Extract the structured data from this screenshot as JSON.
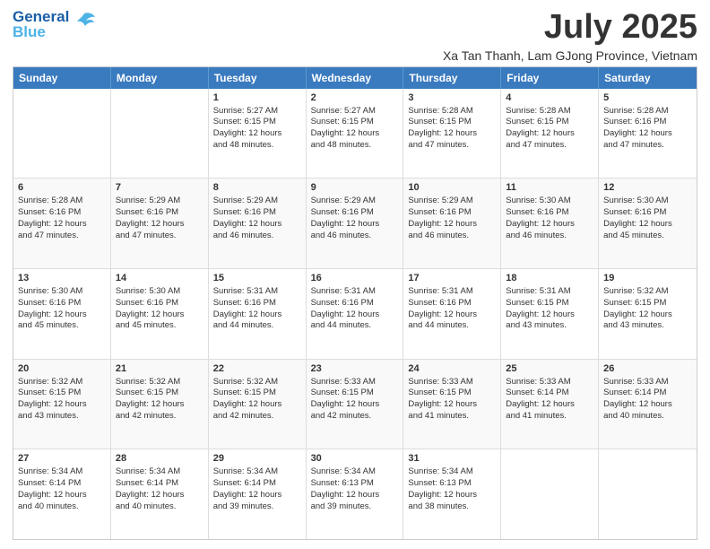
{
  "header": {
    "logo_line1": "General",
    "logo_line2": "Blue",
    "month": "July 2025",
    "location": "Xa Tan Thanh, Lam GJong Province, Vietnam"
  },
  "days_of_week": [
    "Sunday",
    "Monday",
    "Tuesday",
    "Wednesday",
    "Thursday",
    "Friday",
    "Saturday"
  ],
  "weeks": [
    [
      {
        "day": "",
        "info": ""
      },
      {
        "day": "",
        "info": ""
      },
      {
        "day": "1",
        "info": "Sunrise: 5:27 AM\nSunset: 6:15 PM\nDaylight: 12 hours\nand 48 minutes."
      },
      {
        "day": "2",
        "info": "Sunrise: 5:27 AM\nSunset: 6:15 PM\nDaylight: 12 hours\nand 48 minutes."
      },
      {
        "day": "3",
        "info": "Sunrise: 5:28 AM\nSunset: 6:15 PM\nDaylight: 12 hours\nand 47 minutes."
      },
      {
        "day": "4",
        "info": "Sunrise: 5:28 AM\nSunset: 6:15 PM\nDaylight: 12 hours\nand 47 minutes."
      },
      {
        "day": "5",
        "info": "Sunrise: 5:28 AM\nSunset: 6:16 PM\nDaylight: 12 hours\nand 47 minutes."
      }
    ],
    [
      {
        "day": "6",
        "info": "Sunrise: 5:28 AM\nSunset: 6:16 PM\nDaylight: 12 hours\nand 47 minutes."
      },
      {
        "day": "7",
        "info": "Sunrise: 5:29 AM\nSunset: 6:16 PM\nDaylight: 12 hours\nand 47 minutes."
      },
      {
        "day": "8",
        "info": "Sunrise: 5:29 AM\nSunset: 6:16 PM\nDaylight: 12 hours\nand 46 minutes."
      },
      {
        "day": "9",
        "info": "Sunrise: 5:29 AM\nSunset: 6:16 PM\nDaylight: 12 hours\nand 46 minutes."
      },
      {
        "day": "10",
        "info": "Sunrise: 5:29 AM\nSunset: 6:16 PM\nDaylight: 12 hours\nand 46 minutes."
      },
      {
        "day": "11",
        "info": "Sunrise: 5:30 AM\nSunset: 6:16 PM\nDaylight: 12 hours\nand 46 minutes."
      },
      {
        "day": "12",
        "info": "Sunrise: 5:30 AM\nSunset: 6:16 PM\nDaylight: 12 hours\nand 45 minutes."
      }
    ],
    [
      {
        "day": "13",
        "info": "Sunrise: 5:30 AM\nSunset: 6:16 PM\nDaylight: 12 hours\nand 45 minutes."
      },
      {
        "day": "14",
        "info": "Sunrise: 5:30 AM\nSunset: 6:16 PM\nDaylight: 12 hours\nand 45 minutes."
      },
      {
        "day": "15",
        "info": "Sunrise: 5:31 AM\nSunset: 6:16 PM\nDaylight: 12 hours\nand 44 minutes."
      },
      {
        "day": "16",
        "info": "Sunrise: 5:31 AM\nSunset: 6:16 PM\nDaylight: 12 hours\nand 44 minutes."
      },
      {
        "day": "17",
        "info": "Sunrise: 5:31 AM\nSunset: 6:16 PM\nDaylight: 12 hours\nand 44 minutes."
      },
      {
        "day": "18",
        "info": "Sunrise: 5:31 AM\nSunset: 6:15 PM\nDaylight: 12 hours\nand 43 minutes."
      },
      {
        "day": "19",
        "info": "Sunrise: 5:32 AM\nSunset: 6:15 PM\nDaylight: 12 hours\nand 43 minutes."
      }
    ],
    [
      {
        "day": "20",
        "info": "Sunrise: 5:32 AM\nSunset: 6:15 PM\nDaylight: 12 hours\nand 43 minutes."
      },
      {
        "day": "21",
        "info": "Sunrise: 5:32 AM\nSunset: 6:15 PM\nDaylight: 12 hours\nand 42 minutes."
      },
      {
        "day": "22",
        "info": "Sunrise: 5:32 AM\nSunset: 6:15 PM\nDaylight: 12 hours\nand 42 minutes."
      },
      {
        "day": "23",
        "info": "Sunrise: 5:33 AM\nSunset: 6:15 PM\nDaylight: 12 hours\nand 42 minutes."
      },
      {
        "day": "24",
        "info": "Sunrise: 5:33 AM\nSunset: 6:15 PM\nDaylight: 12 hours\nand 41 minutes."
      },
      {
        "day": "25",
        "info": "Sunrise: 5:33 AM\nSunset: 6:14 PM\nDaylight: 12 hours\nand 41 minutes."
      },
      {
        "day": "26",
        "info": "Sunrise: 5:33 AM\nSunset: 6:14 PM\nDaylight: 12 hours\nand 40 minutes."
      }
    ],
    [
      {
        "day": "27",
        "info": "Sunrise: 5:34 AM\nSunset: 6:14 PM\nDaylight: 12 hours\nand 40 minutes."
      },
      {
        "day": "28",
        "info": "Sunrise: 5:34 AM\nSunset: 6:14 PM\nDaylight: 12 hours\nand 40 minutes."
      },
      {
        "day": "29",
        "info": "Sunrise: 5:34 AM\nSunset: 6:14 PM\nDaylight: 12 hours\nand 39 minutes."
      },
      {
        "day": "30",
        "info": "Sunrise: 5:34 AM\nSunset: 6:13 PM\nDaylight: 12 hours\nand 39 minutes."
      },
      {
        "day": "31",
        "info": "Sunrise: 5:34 AM\nSunset: 6:13 PM\nDaylight: 12 hours\nand 38 minutes."
      },
      {
        "day": "",
        "info": ""
      },
      {
        "day": "",
        "info": ""
      }
    ]
  ]
}
